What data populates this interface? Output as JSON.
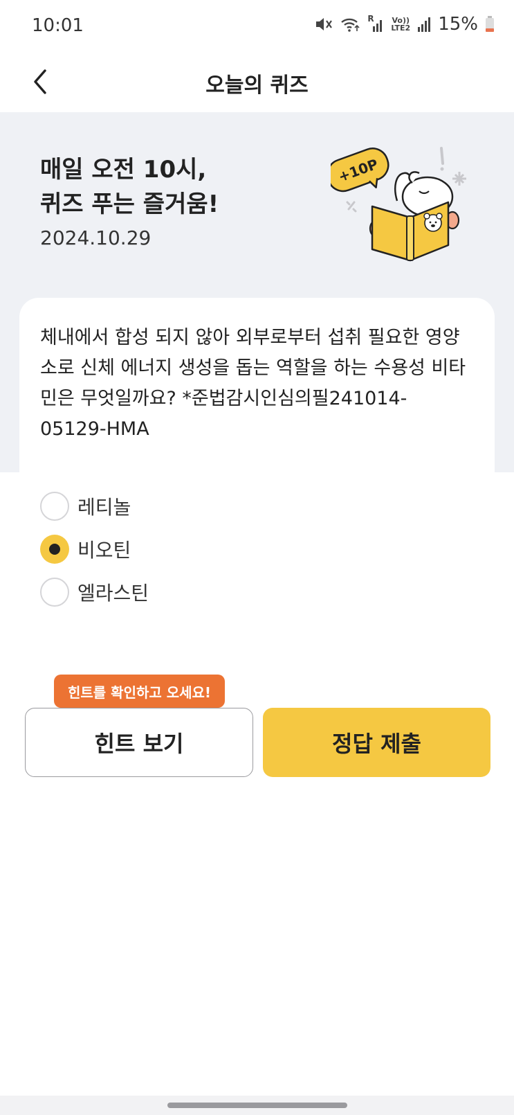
{
  "status_bar": {
    "time": "10:01",
    "battery": "15%",
    "icons": [
      "mute-icon",
      "wifi-icon",
      "signal-r-icon",
      "volte-lte2-icon",
      "signal-icon",
      "battery-icon"
    ],
    "volte_label_top": "Vo))",
    "volte_label_bottom": "LTE2",
    "roaming_label": "R"
  },
  "header": {
    "title": "오늘의 퀴즈",
    "back_icon": "chevron-left-icon"
  },
  "hero": {
    "title_line1": "매일 오전 10시,",
    "title_line2": "퀴즈 푸는 즐거움!",
    "date": "2024.10.29",
    "badge": "+10P"
  },
  "question": {
    "line1": "체내에서 합성 되지 않아 외부로부터 섭취 필요한 영양",
    "line2": "소로 신체 에너지 생성을 돕는 역할을 하는 수용성 비타",
    "line3": "민은 무엇일까요? *준법감시인심의필241014-",
    "line4": "05129-HMA"
  },
  "options": [
    {
      "label": "레티놀",
      "selected": false
    },
    {
      "label": "비오틴",
      "selected": true
    },
    {
      "label": "엘라스틴",
      "selected": false
    }
  ],
  "tooltip": "힌트를 확인하고 오세요!",
  "buttons": {
    "hint": "힌트 보기",
    "submit": "정답 제출"
  },
  "colors": {
    "accent_yellow": "#f5c842",
    "tooltip_orange": "#ec7333",
    "hero_bg": "#eff1f5"
  }
}
